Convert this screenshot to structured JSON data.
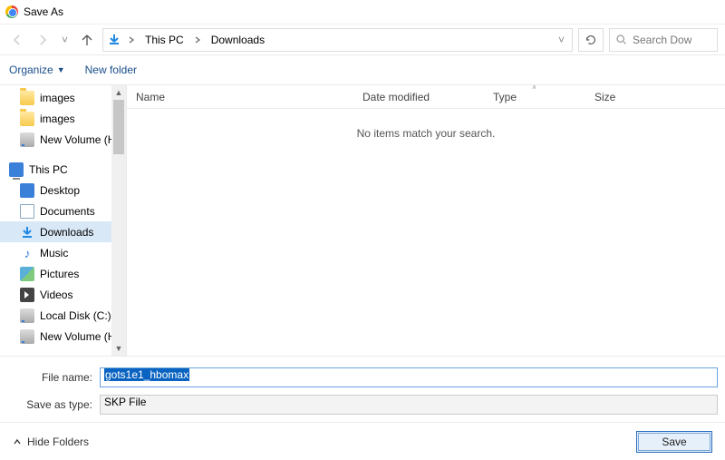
{
  "title": "Save As",
  "breadcrumb": [
    "This PC",
    "Downloads"
  ],
  "search": {
    "placeholder": "Search Dow"
  },
  "toolbar": {
    "organize": "Organize",
    "newfolder": "New folder"
  },
  "sidebar": {
    "items": [
      {
        "label": "images",
        "icon": "folder",
        "level": 1
      },
      {
        "label": "images",
        "icon": "folder",
        "level": 1
      },
      {
        "label": "New Volume (H:",
        "icon": "drive",
        "level": 1
      },
      {
        "spacer": true
      },
      {
        "label": "This PC",
        "icon": "pc",
        "level": 0
      },
      {
        "label": "Desktop",
        "icon": "desktop",
        "level": 1
      },
      {
        "label": "Documents",
        "icon": "doc",
        "level": 1
      },
      {
        "label": "Downloads",
        "icon": "download",
        "level": 1,
        "selected": true
      },
      {
        "label": "Music",
        "icon": "music",
        "level": 1
      },
      {
        "label": "Pictures",
        "icon": "pic",
        "level": 1
      },
      {
        "label": "Videos",
        "icon": "vid",
        "level": 1
      },
      {
        "label": "Local Disk (C:)",
        "icon": "drive",
        "level": 1
      },
      {
        "label": "New Volume (H:",
        "icon": "drive",
        "level": 1
      }
    ]
  },
  "columns": {
    "name": "Name",
    "date": "Date modified",
    "type": "Type",
    "size": "Size"
  },
  "empty_message": "No items match your search.",
  "form": {
    "filename_label": "File name:",
    "filename_value": "gots1e1_hbomax",
    "filetype_label": "Save as type:",
    "filetype_value": "SKP File"
  },
  "bottom": {
    "hide": "Hide Folders",
    "save": "Save"
  }
}
